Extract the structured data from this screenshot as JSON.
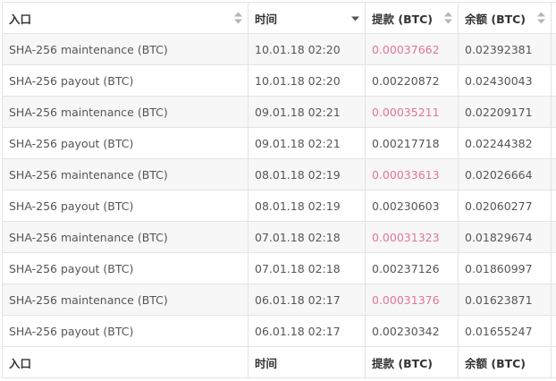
{
  "header": {
    "col1": "入口",
    "col2": "时间",
    "col3": "提款 (BTC)",
    "col4": "余额 (BTC)"
  },
  "footer": {
    "col1": "入口",
    "col2": "时间",
    "col3": "提款 (BTC)",
    "col4": "余额 (BTC)"
  },
  "colors": {
    "withdraw_highlight": "#e2749d",
    "row_stripe": "#f7f7f7",
    "border": "#e3e3e3"
  },
  "sort_icons": {
    "col1": "sort-both-icon",
    "col2": "sort-desc-icon",
    "col3": "sort-both-icon",
    "col4": "sort-both-icon"
  },
  "rows": [
    {
      "entry": "SHA-256 maintenance (BTC)",
      "time": "10.01.18 02:20",
      "withdraw": "0.00037662",
      "balance": "0.02392381",
      "highlight": true
    },
    {
      "entry": "SHA-256 payout (BTC)",
      "time": "10.01.18 02:20",
      "withdraw": "0.00220872",
      "balance": "0.02430043",
      "highlight": false
    },
    {
      "entry": "SHA-256 maintenance (BTC)",
      "time": "09.01.18 02:21",
      "withdraw": "0.00035211",
      "balance": "0.02209171",
      "highlight": true
    },
    {
      "entry": "SHA-256 payout (BTC)",
      "time": "09.01.18 02:21",
      "withdraw": "0.00217718",
      "balance": "0.02244382",
      "highlight": false
    },
    {
      "entry": "SHA-256 maintenance (BTC)",
      "time": "08.01.18 02:19",
      "withdraw": "0.00033613",
      "balance": "0.02026664",
      "highlight": true
    },
    {
      "entry": "SHA-256 payout (BTC)",
      "time": "08.01.18 02:19",
      "withdraw": "0.00230603",
      "balance": "0.02060277",
      "highlight": false
    },
    {
      "entry": "SHA-256 maintenance (BTC)",
      "time": "07.01.18 02:18",
      "withdraw": "0.00031323",
      "balance": "0.01829674",
      "highlight": true
    },
    {
      "entry": "SHA-256 payout (BTC)",
      "time": "07.01.18 02:18",
      "withdraw": "0.00237126",
      "balance": "0.01860997",
      "highlight": false
    },
    {
      "entry": "SHA-256 maintenance (BTC)",
      "time": "06.01.18 02:17",
      "withdraw": "0.00031376",
      "balance": "0.01623871",
      "highlight": true
    },
    {
      "entry": "SHA-256 payout (BTC)",
      "time": "06.01.18 02:17",
      "withdraw": "0.00230342",
      "balance": "0.01655247",
      "highlight": false
    }
  ]
}
